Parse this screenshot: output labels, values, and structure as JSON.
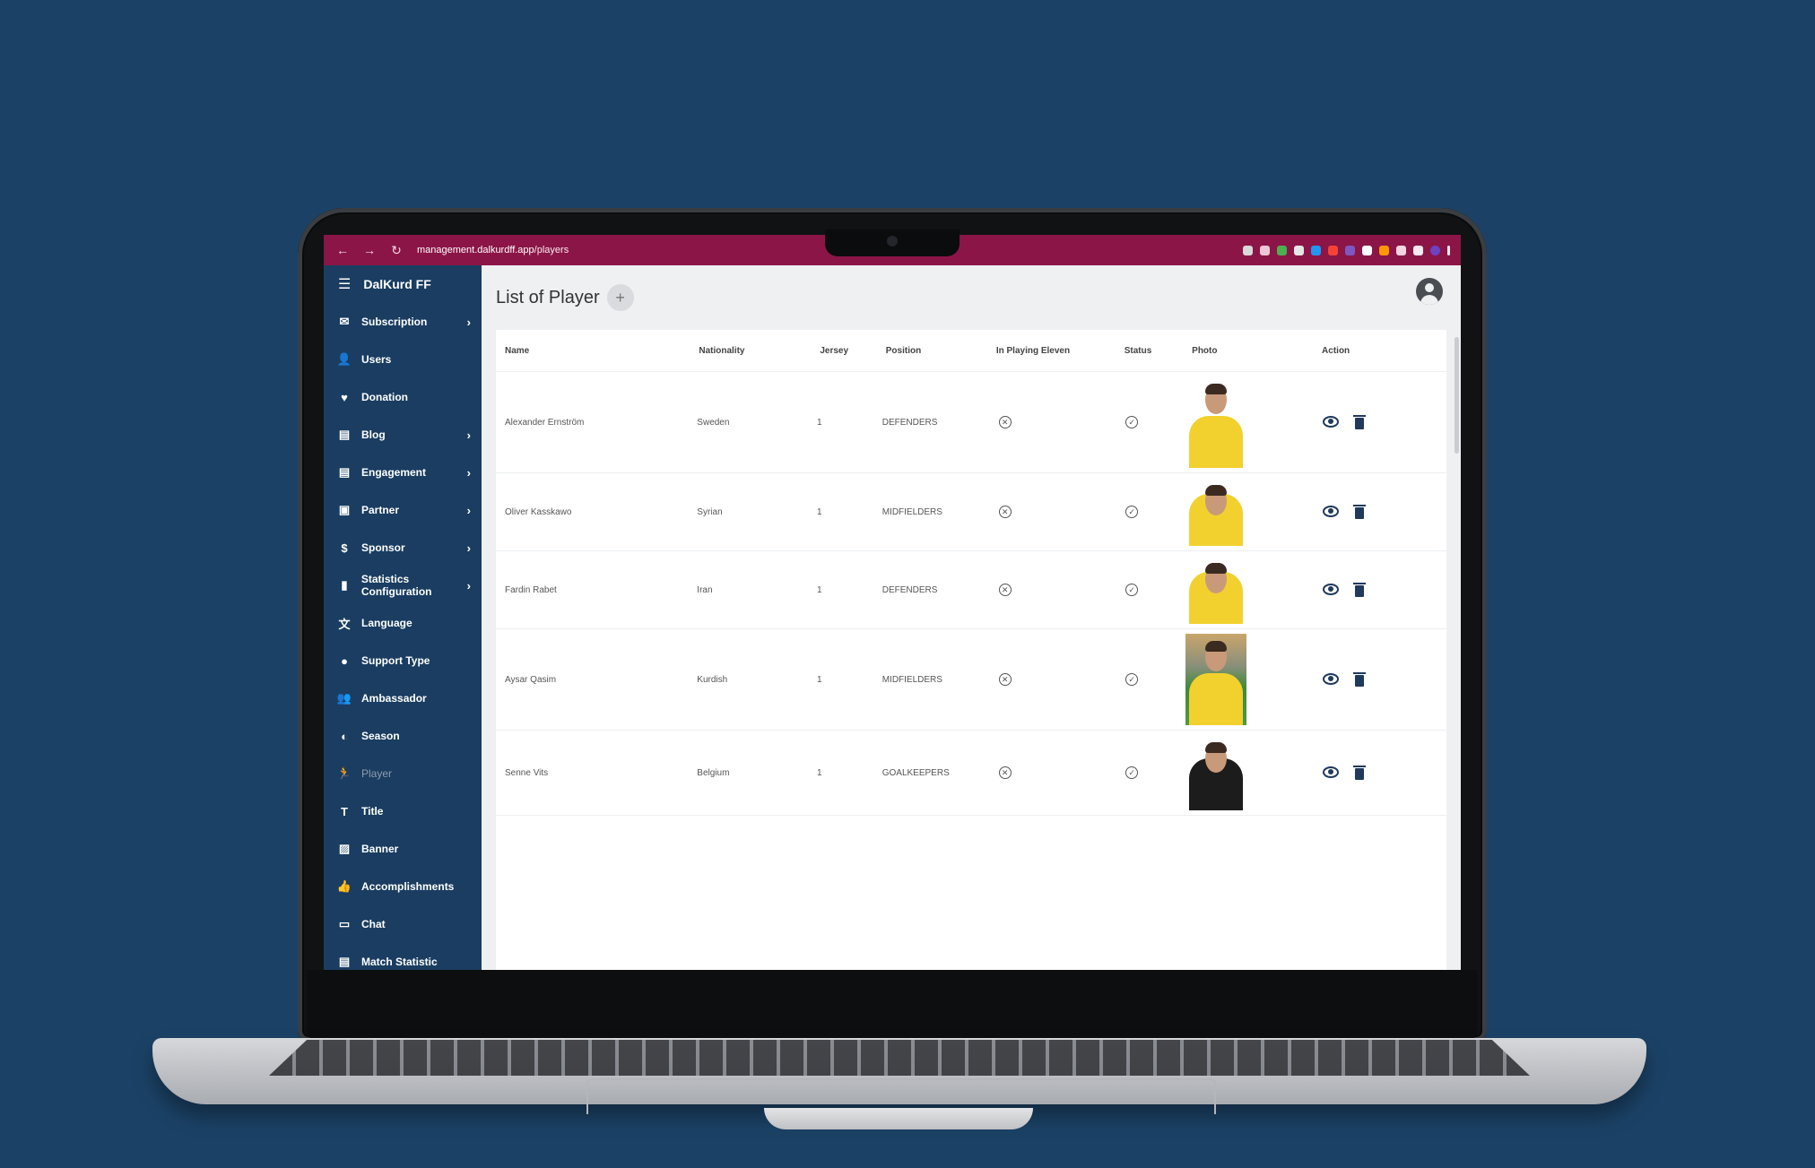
{
  "browser": {
    "url_host": "management.dalkurdff.app",
    "url_path": "/players"
  },
  "sidebar": {
    "brand": "DalKurd FF",
    "items": [
      {
        "label": "Subscription",
        "icon": "subscription-icon",
        "glyph": "✉",
        "chevron": true
      },
      {
        "label": "Users",
        "icon": "user-icon",
        "glyph": "👤",
        "chevron": false
      },
      {
        "label": "Donation",
        "icon": "heart-icon",
        "glyph": "♥",
        "chevron": false
      },
      {
        "label": "Blog",
        "icon": "blog-icon",
        "glyph": "▤",
        "chevron": true
      },
      {
        "label": "Engagement",
        "icon": "engagement-icon",
        "glyph": "▤",
        "chevron": true
      },
      {
        "label": "Partner",
        "icon": "partner-icon",
        "glyph": "▣",
        "chevron": true
      },
      {
        "label": "Sponsor",
        "icon": "dollar-icon",
        "glyph": "$",
        "chevron": true
      },
      {
        "label": "Statistics Configuration",
        "icon": "bar-chart-icon",
        "glyph": "▮",
        "chevron": true
      },
      {
        "label": "Language",
        "icon": "translate-icon",
        "glyph": "文",
        "chevron": false
      },
      {
        "label": "Support Type",
        "icon": "support-icon",
        "glyph": "●",
        "chevron": false
      },
      {
        "label": "Ambassador",
        "icon": "people-icon",
        "glyph": "👥",
        "chevron": false
      },
      {
        "label": "Season",
        "icon": "season-icon",
        "glyph": "◐",
        "chevron": false
      },
      {
        "label": "Player",
        "icon": "player-icon",
        "glyph": "🏃",
        "chevron": false,
        "active": true
      },
      {
        "label": "Title",
        "icon": "text-size-icon",
        "glyph": "T",
        "chevron": false
      },
      {
        "label": "Banner",
        "icon": "image-icon",
        "glyph": "▨",
        "chevron": false
      },
      {
        "label": "Accomplishments",
        "icon": "thumb-up-icon",
        "glyph": "👍",
        "chevron": false
      },
      {
        "label": "Chat",
        "icon": "chat-icon",
        "glyph": "▭",
        "chevron": false
      },
      {
        "label": "Match Statistic",
        "icon": "stats-icon",
        "glyph": "▤",
        "chevron": false
      }
    ]
  },
  "main": {
    "title": "List of Player",
    "add_label": "+",
    "columns": [
      "Name",
      "Nationality",
      "Jersey",
      "Position",
      "In Playing Eleven",
      "Status",
      "Photo",
      "Action"
    ],
    "rows": [
      {
        "name": "Alexander Ernström",
        "nationality": "Sweden",
        "jersey": "1",
        "position": "DEFENDERS"
      },
      {
        "name": "Oliver Kasskawo",
        "nationality": "Syrian",
        "jersey": "1",
        "position": "MIDFIELDERS"
      },
      {
        "name": "Fardin Rabet",
        "nationality": "Iran",
        "jersey": "1",
        "position": "DEFENDERS"
      },
      {
        "name": "Aysar Qasim",
        "nationality": "Kurdish",
        "jersey": "1",
        "position": "MIDFIELDERS"
      },
      {
        "name": "Senne Vits",
        "nationality": "Belgium",
        "jersey": "1",
        "position": "GOALKEEPERS"
      }
    ]
  },
  "colors": {
    "page_bg": "#1b4266",
    "browser_bar": "#8b1547",
    "sidebar_bg": "#1a3d61",
    "kit_yellow": "#f2d12e",
    "kit_black": "#1c1c1c",
    "action_icon": "#1f3a5c"
  }
}
